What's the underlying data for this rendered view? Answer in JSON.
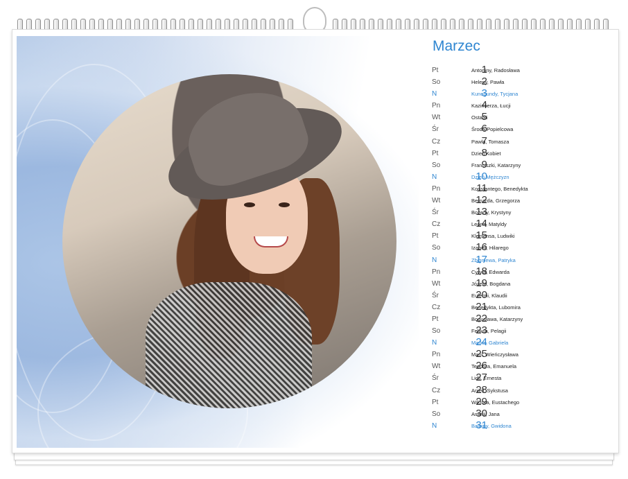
{
  "calendar": {
    "month": "Marzec",
    "days": [
      {
        "dow": "Pt",
        "num": "1",
        "names": "Antoniny, Radosława",
        "sunday": false
      },
      {
        "dow": "So",
        "num": "2",
        "names": "Heleny, Pawła",
        "sunday": false
      },
      {
        "dow": "N",
        "num": "3",
        "names": "Kunegundy, Tycjana",
        "sunday": true
      },
      {
        "dow": "Pn",
        "num": "4",
        "names": "Kazimierza, Łucji",
        "sunday": false
      },
      {
        "dow": "Wt",
        "num": "5",
        "names": "Ostatki",
        "sunday": false
      },
      {
        "dow": "Śr",
        "num": "6",
        "names": "Środa Popielcowa",
        "sunday": false
      },
      {
        "dow": "Cz",
        "num": "7",
        "names": "Pawła, Tomasza",
        "sunday": false
      },
      {
        "dow": "Pt",
        "num": "8",
        "names": "Dzień Kobiet",
        "sunday": false
      },
      {
        "dow": "So",
        "num": "9",
        "names": "Franciszki, Katarzyny",
        "sunday": false
      },
      {
        "dow": "N",
        "num": "10",
        "names": "Dzień Mężczyzn",
        "sunday": true
      },
      {
        "dow": "Pn",
        "num": "11",
        "names": "Konstantego, Benedykta",
        "sunday": false
      },
      {
        "dow": "Wt",
        "num": "12",
        "names": "Bernarda, Grzegorza",
        "sunday": false
      },
      {
        "dow": "Śr",
        "num": "13",
        "names": "Bożeny, Krystyny",
        "sunday": false
      },
      {
        "dow": "Cz",
        "num": "14",
        "names": "Leona, Matyldy",
        "sunday": false
      },
      {
        "dow": "Pt",
        "num": "15",
        "names": "Klemensa, Ludwiki",
        "sunday": false
      },
      {
        "dow": "So",
        "num": "16",
        "names": "Izabeli, Hilarego",
        "sunday": false
      },
      {
        "dow": "N",
        "num": "17",
        "names": "Zbigniewa, Patryka",
        "sunday": true
      },
      {
        "dow": "Pn",
        "num": "18",
        "names": "Cyryla, Edwarda",
        "sunday": false
      },
      {
        "dow": "Wt",
        "num": "19",
        "names": "Józefa, Bogdana",
        "sunday": false
      },
      {
        "dow": "Śr",
        "num": "20",
        "names": "Eufemii, Klaudii",
        "sunday": false
      },
      {
        "dow": "Cz",
        "num": "21",
        "names": "Benedykta, Lubomira",
        "sunday": false
      },
      {
        "dow": "Pt",
        "num": "22",
        "names": "Bogusława, Katarzyny",
        "sunday": false
      },
      {
        "dow": "So",
        "num": "23",
        "names": "Feliksa, Pelagii",
        "sunday": false
      },
      {
        "dow": "N",
        "num": "24",
        "names": "Marka, Gabriela",
        "sunday": true
      },
      {
        "dow": "Pn",
        "num": "25",
        "names": "Marii, Wieńczysława",
        "sunday": false
      },
      {
        "dow": "Wt",
        "num": "26",
        "names": "Teodora, Emanuela",
        "sunday": false
      },
      {
        "dow": "Śr",
        "num": "27",
        "names": "Lidii, Ernesta",
        "sunday": false
      },
      {
        "dow": "Cz",
        "num": "28",
        "names": "Anieli, Sykstusa",
        "sunday": false
      },
      {
        "dow": "Pt",
        "num": "29",
        "names": "Wiktora, Eustachego",
        "sunday": false
      },
      {
        "dow": "So",
        "num": "30",
        "names": "Amelii, Jana",
        "sunday": false
      },
      {
        "dow": "N",
        "num": "31",
        "names": "Balbiny, Gwidona",
        "sunday": true
      }
    ]
  },
  "colors": {
    "accent": "#2f86d1",
    "text": "#333333",
    "marble_blue": "#b6cbe8"
  }
}
